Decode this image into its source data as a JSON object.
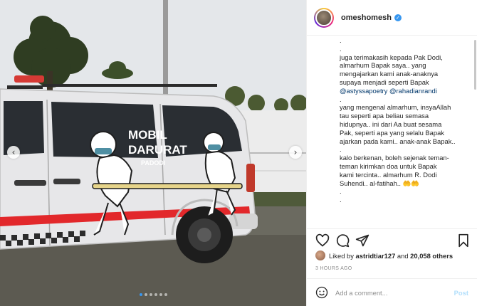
{
  "post": {
    "photo": {
      "alt_subject": "ambulance",
      "van_text": [
        "MOBIL",
        "DARURAT"
      ],
      "van_subtext": "PADODI",
      "carousel": {
        "count": 6,
        "active_index": 0
      }
    },
    "header": {
      "username": "omeshomesh",
      "verified": true
    },
    "caption_lines": [
      ".",
      ".",
      "juga terimakasih kepada Pak Dodi,",
      "almarhum Bapak saya.. yang",
      "mengajarkan kami anak-anaknya",
      "supaya menjadi seperti Bapak",
      "@astyssapoetry @rahadianrandi",
      ".",
      "yang mengenal almarhum, insyaAllah",
      "tau seperti apa beliau semasa",
      "hidupnya.. ini dari Aa buat sesama",
      "Pak, seperti apa yang selalu Bapak",
      "ajarkan pada kami.. anak-anak Bapak..",
      ".",
      "kalo berkenan, boleh sejenak teman-",
      "teman kirimkan doa untuk Bapak",
      "kami tercinta.. almarhum R. Dodi",
      "Suhendi.. al-fatihah.. 🤲🤲",
      ".",
      "."
    ],
    "likes": {
      "prefix": "Liked by ",
      "user": "astridtiar127",
      "middle": " and ",
      "count": "20,058 others"
    },
    "time_ago": "3 HOURS AGO",
    "comment": {
      "placeholder": "Add a comment...",
      "post_label": "Post"
    },
    "colors": {
      "accent": "#3897f0",
      "post_disabled": "#b2dffc",
      "mention": "#00376b"
    }
  }
}
